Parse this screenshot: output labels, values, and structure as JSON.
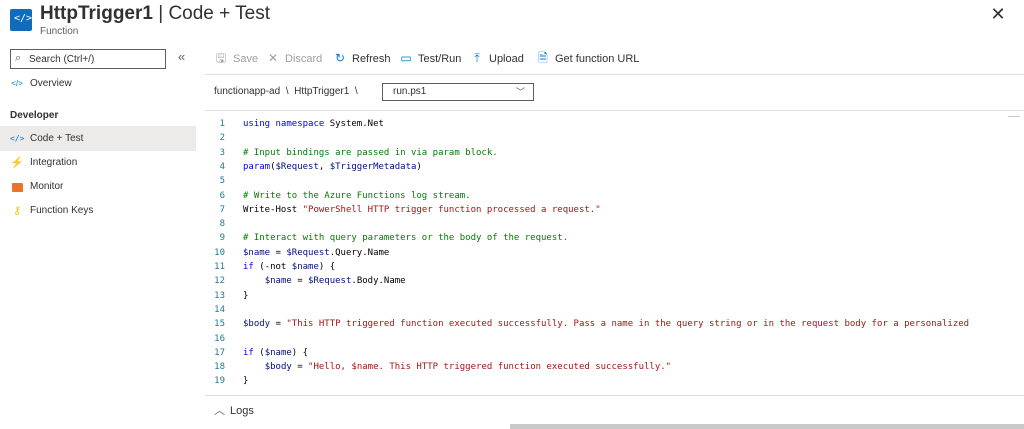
{
  "header": {
    "title": "HttpTrigger1",
    "separator": "|",
    "title_suffix": "Code + Test",
    "subtitle": "Function",
    "app_icon": "</>",
    "close_icon": "✕"
  },
  "sidebar": {
    "search_placeholder": "Search (Ctrl+/)",
    "collapse_icon": "«",
    "overview": {
      "label": "Overview",
      "icon": "</>"
    },
    "section_label": "Developer",
    "items": [
      {
        "label": "Code + Test",
        "icon": "code-icon",
        "active": true
      },
      {
        "label": "Integration",
        "icon": "lightning-icon"
      },
      {
        "label": "Monitor",
        "icon": "monitor-icon"
      },
      {
        "label": "Function Keys",
        "icon": "key-icon"
      }
    ]
  },
  "toolbar": {
    "save": "Save",
    "discard": "Discard",
    "refresh": "Refresh",
    "test_run": "Test/Run",
    "upload": "Upload",
    "get_url": "Get function URL"
  },
  "breadcrumb": {
    "app": "functionapp-ad",
    "sep": "\\",
    "function": "HttpTrigger1",
    "file": "run.ps1"
  },
  "editor": {
    "lines": [
      {
        "n": "1",
        "code": "using namespace System.Net"
      },
      {
        "n": "2",
        "code": ""
      },
      {
        "n": "3",
        "code": "# Input bindings are passed in via param block."
      },
      {
        "n": "4",
        "code": "param($Request, $TriggerMetadata)"
      },
      {
        "n": "5",
        "code": ""
      },
      {
        "n": "6",
        "code": "# Write to the Azure Functions log stream."
      },
      {
        "n": "7",
        "code": "Write-Host \"PowerShell HTTP trigger function processed a request.\""
      },
      {
        "n": "8",
        "code": ""
      },
      {
        "n": "9",
        "code": "# Interact with query parameters or the body of the request."
      },
      {
        "n": "10",
        "code": "$name = $Request.Query.Name"
      },
      {
        "n": "11",
        "code": "if (-not $name) {"
      },
      {
        "n": "12",
        "code": "    $name = $Request.Body.Name"
      },
      {
        "n": "13",
        "code": "}"
      },
      {
        "n": "14",
        "code": ""
      },
      {
        "n": "15",
        "code": "$body = \"This HTTP triggered function executed successfully. Pass a name in the query string or in the request body for a personalized"
      },
      {
        "n": "16",
        "code": ""
      },
      {
        "n": "17",
        "code": "if ($name) {"
      },
      {
        "n": "18",
        "code": "    $body = \"Hello, $name. This HTTP triggered function executed successfully.\""
      },
      {
        "n": "19",
        "code": "}"
      }
    ]
  },
  "logs": {
    "label": "Logs",
    "chevron": "^"
  }
}
